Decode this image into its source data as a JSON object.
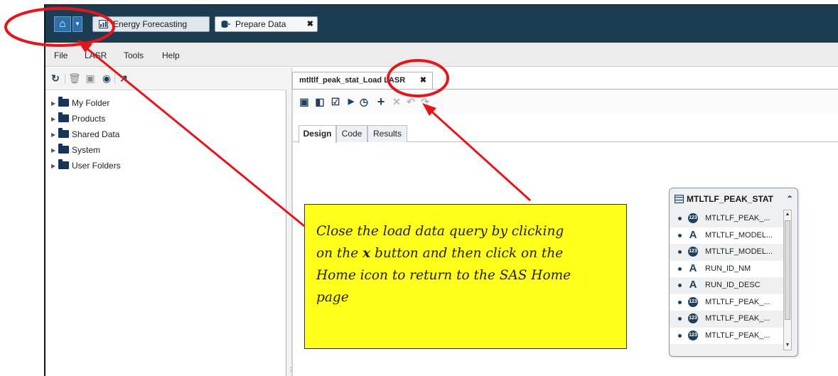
{
  "appbar": {
    "tabs": [
      {
        "label": "Energy Forecasting",
        "icon": "report-icon"
      },
      {
        "label": "Prepare Data",
        "icon": "prepare-data-icon",
        "close": "✖"
      }
    ]
  },
  "menubar": {
    "items": [
      "File",
      "LASR",
      "Tools",
      "Help"
    ]
  },
  "tree": {
    "items": [
      "My Folder",
      "Products",
      "Shared Data",
      "System",
      "User Folders"
    ]
  },
  "document": {
    "tab_label": "mtltlf_peak_stat_Load LASR",
    "tab_close": "✖",
    "subtabs": [
      "Design",
      "Code",
      "Results"
    ],
    "active_subtab": "Design"
  },
  "table_node": {
    "title": "MTLTLF_PEAK_STAT",
    "columns": [
      {
        "name": "MTLTLF_PEAK_...",
        "type": "numeric"
      },
      {
        "name": "MTLTLF_MODEL...",
        "type": "character"
      },
      {
        "name": "MTLTLF_MODEL...",
        "type": "numeric"
      },
      {
        "name": "RUN_ID_NM",
        "type": "character"
      },
      {
        "name": "RUN_ID_DESC",
        "type": "character"
      },
      {
        "name": "MTLTLF_PEAK_...",
        "type": "numeric"
      },
      {
        "name": "MTLTLF_PEAK_...",
        "type": "numeric"
      },
      {
        "name": "MTLTLF_PEAK_...",
        "type": "numeric"
      }
    ]
  },
  "callout": {
    "line1": "Close the load data query by clicking",
    "line2_pre": "on the ",
    "line2_x": "x",
    "line2_post": " button and then click on the",
    "line3": "Home icon to return to the SAS Home",
    "line4": "page"
  },
  "colors": {
    "appbar": "#1c3c52",
    "annotation": "#e8141b",
    "callout_bg": "#ffff1a"
  }
}
